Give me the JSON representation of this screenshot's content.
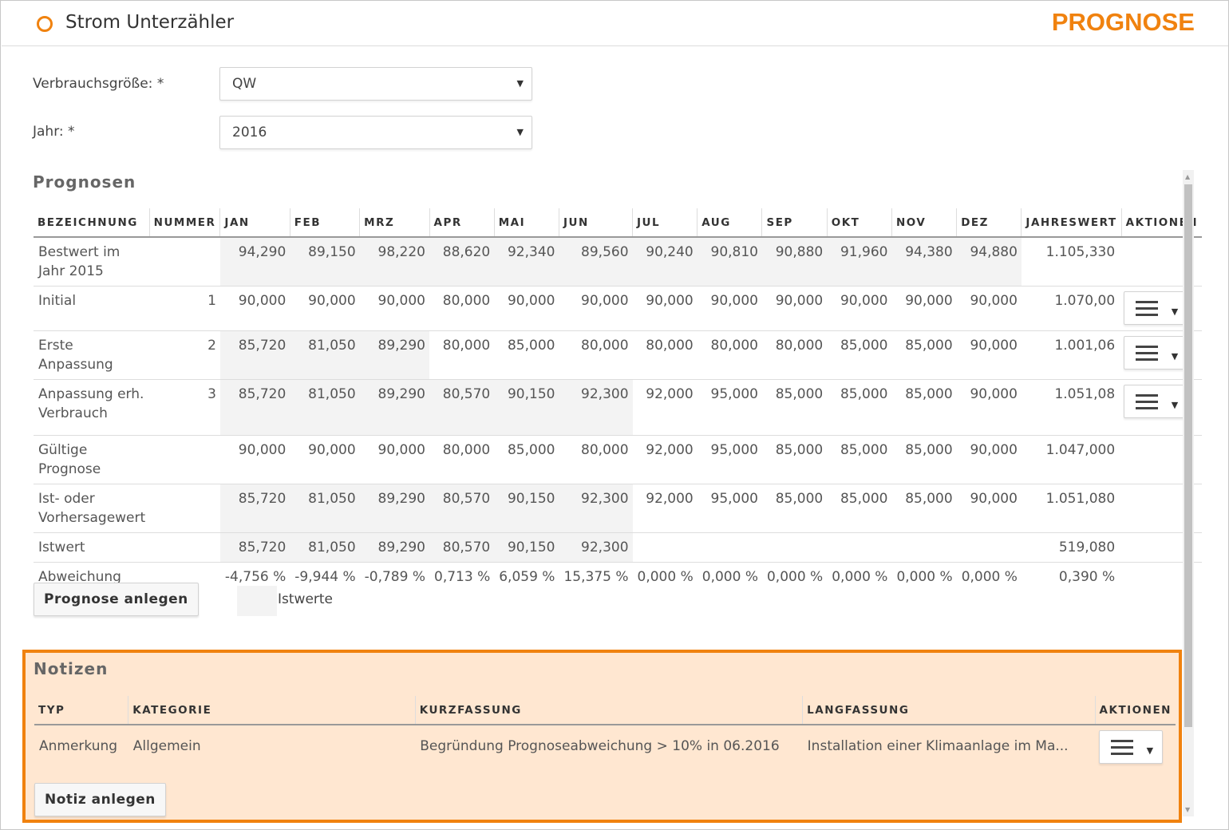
{
  "header": {
    "title": "Strom Unterzähler",
    "page_label": "PROGNOSE",
    "accent": "#f0820f"
  },
  "form": {
    "consumption_label": "Verbrauchsgröße: *",
    "consumption_value": "QW",
    "year_label": "Jahr: *",
    "year_value": "2016"
  },
  "forecasts": {
    "title": "Prognosen",
    "columns": [
      "BEZEICHNUNG",
      "NUMMER",
      "JAN",
      "FEB",
      "MRZ",
      "APR",
      "MAI",
      "JUN",
      "JUL",
      "AUG",
      "SEP",
      "OKT",
      "NOV",
      "DEZ",
      "JAHRESWERT",
      "AKTIONEN"
    ],
    "rows": [
      {
        "name": "Bestwert im Jahr 2015",
        "number": "",
        "values": [
          "94,290",
          "89,150",
          "98,220",
          "88,620",
          "92,340",
          "89,560",
          "90,240",
          "90,810",
          "90,880",
          "91,960",
          "94,380",
          "94,880"
        ],
        "total": "1.105,330",
        "actions": false,
        "shade": 12
      },
      {
        "name": "Initial",
        "number": "1",
        "values": [
          "90,000",
          "90,000",
          "90,000",
          "80,000",
          "90,000",
          "90,000",
          "90,000",
          "90,000",
          "90,000",
          "90,000",
          "90,000",
          "90,000"
        ],
        "total": "1.070,00",
        "actions": true,
        "shade": 0
      },
      {
        "name": "Erste Anpassung",
        "number": "2",
        "values": [
          "85,720",
          "81,050",
          "89,290",
          "80,000",
          "85,000",
          "80,000",
          "80,000",
          "80,000",
          "80,000",
          "85,000",
          "85,000",
          "90,000"
        ],
        "total": "1.001,06",
        "actions": true,
        "shade": 3
      },
      {
        "name": "Anpassung erh. Verbrauch",
        "number": "3",
        "values": [
          "85,720",
          "81,050",
          "89,290",
          "80,570",
          "90,150",
          "92,300",
          "92,000",
          "95,000",
          "85,000",
          "85,000",
          "85,000",
          "90,000"
        ],
        "total": "1.051,08",
        "actions": true,
        "shade": 6
      },
      {
        "name": "Gültige Prognose",
        "number": "",
        "values": [
          "90,000",
          "90,000",
          "90,000",
          "80,000",
          "85,000",
          "80,000",
          "92,000",
          "95,000",
          "85,000",
          "85,000",
          "85,000",
          "90,000"
        ],
        "total": "1.047,000",
        "actions": false,
        "shade": 0
      },
      {
        "name": "Ist- oder Vorhersagewert",
        "number": "",
        "values": [
          "85,720",
          "81,050",
          "89,290",
          "80,570",
          "90,150",
          "92,300",
          "92,000",
          "95,000",
          "85,000",
          "85,000",
          "85,000",
          "90,000"
        ],
        "total": "1.051,080",
        "actions": false,
        "shade": 6
      },
      {
        "name": "Istwert",
        "number": "",
        "values": [
          "85,720",
          "81,050",
          "89,290",
          "80,570",
          "90,150",
          "92,300",
          "",
          "",
          "",
          "",
          "",
          ""
        ],
        "total": "519,080",
        "actions": false,
        "shade": 6
      },
      {
        "name": "Abweichung",
        "number": "",
        "values": [
          "-4,756 %",
          "-9,944 %",
          "-0,789 %",
          "0,713 %",
          "6,059 %",
          "15,375 %",
          "0,000 %",
          "0,000 %",
          "0,000 %",
          "0,000 %",
          "0,000 %",
          "0,000 %"
        ],
        "total": "0,390 %",
        "actions": false,
        "shade": 0
      }
    ],
    "create_button": "Prognose anlegen",
    "legend_label": "Istwerte"
  },
  "notes": {
    "title": "Notizen",
    "columns": [
      "TYP",
      "KATEGORIE",
      "KURZFASSUNG",
      "LANGFASSUNG",
      "AKTIONEN"
    ],
    "rows": [
      {
        "type": "Anmerkung",
        "category": "Allgemein",
        "short": "Begründung Prognoseabweichung > 10% in 06.2016",
        "long": "Installation einer Klimaanlage im Ma..."
      }
    ],
    "create_button": "Notiz anlegen"
  }
}
